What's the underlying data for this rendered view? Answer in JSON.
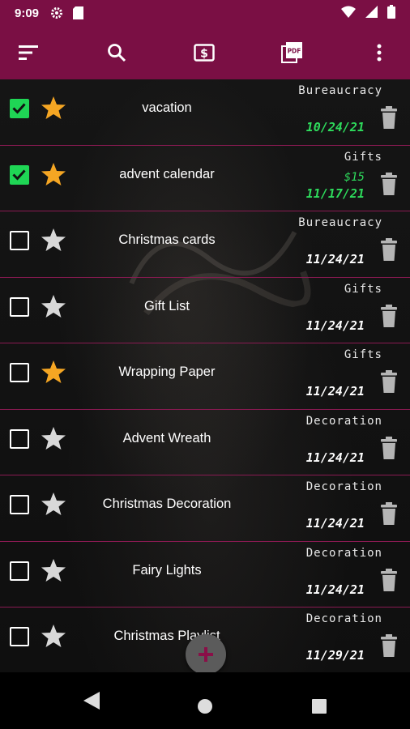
{
  "status_bar": {
    "time": "9:09",
    "icons": [
      "gear-icon",
      "sd-card-icon",
      "wifi-icon",
      "signal-icon",
      "battery-icon"
    ]
  },
  "app_bar": {
    "background": "#7a0f44",
    "actions": [
      "sort-icon",
      "search-icon",
      "dollar-icon",
      "pdf-icon",
      "more-vert-icon"
    ]
  },
  "tasks": [
    {
      "title": "vacation",
      "category": "Bureaucracy",
      "price": "",
      "date": "10/24/21",
      "checked": true,
      "starred": true,
      "date_green": true
    },
    {
      "title": "advent calendar",
      "category": "Gifts",
      "price": "$15",
      "date": "11/17/21",
      "checked": true,
      "starred": true,
      "date_green": true
    },
    {
      "title": "Christmas cards",
      "category": "Bureaucracy",
      "price": "",
      "date": "11/24/21",
      "checked": false,
      "starred": false,
      "date_green": false
    },
    {
      "title": "Gift List",
      "category": "Gifts",
      "price": "",
      "date": "11/24/21",
      "checked": false,
      "starred": false,
      "date_green": false
    },
    {
      "title": "Wrapping Paper",
      "category": "Gifts",
      "price": "",
      "date": "11/24/21",
      "checked": false,
      "starred": true,
      "date_green": false
    },
    {
      "title": "Advent Wreath",
      "category": "Decoration",
      "price": "",
      "date": "11/24/21",
      "checked": false,
      "starred": false,
      "date_green": false
    },
    {
      "title": "Christmas Decoration",
      "category": "Decoration",
      "price": "",
      "date": "11/24/21",
      "checked": false,
      "starred": false,
      "date_green": false
    },
    {
      "title": "Fairy Lights",
      "category": "Decoration",
      "price": "",
      "date": "11/24/21",
      "checked": false,
      "starred": false,
      "date_green": false
    },
    {
      "title": "Christmas Playlist",
      "category": "Decoration",
      "price": "",
      "date": "11/29/21",
      "checked": false,
      "starred": false,
      "date_green": false
    }
  ],
  "fab": {
    "icon": "add-icon"
  },
  "nav_bar": {
    "icons": [
      "back-icon",
      "home-icon",
      "recents-icon"
    ]
  },
  "colors": {
    "accent": "#7a0f44",
    "check_green": "#1fd655",
    "star_gold": "#f5a623",
    "divider": "#8a1a52"
  }
}
